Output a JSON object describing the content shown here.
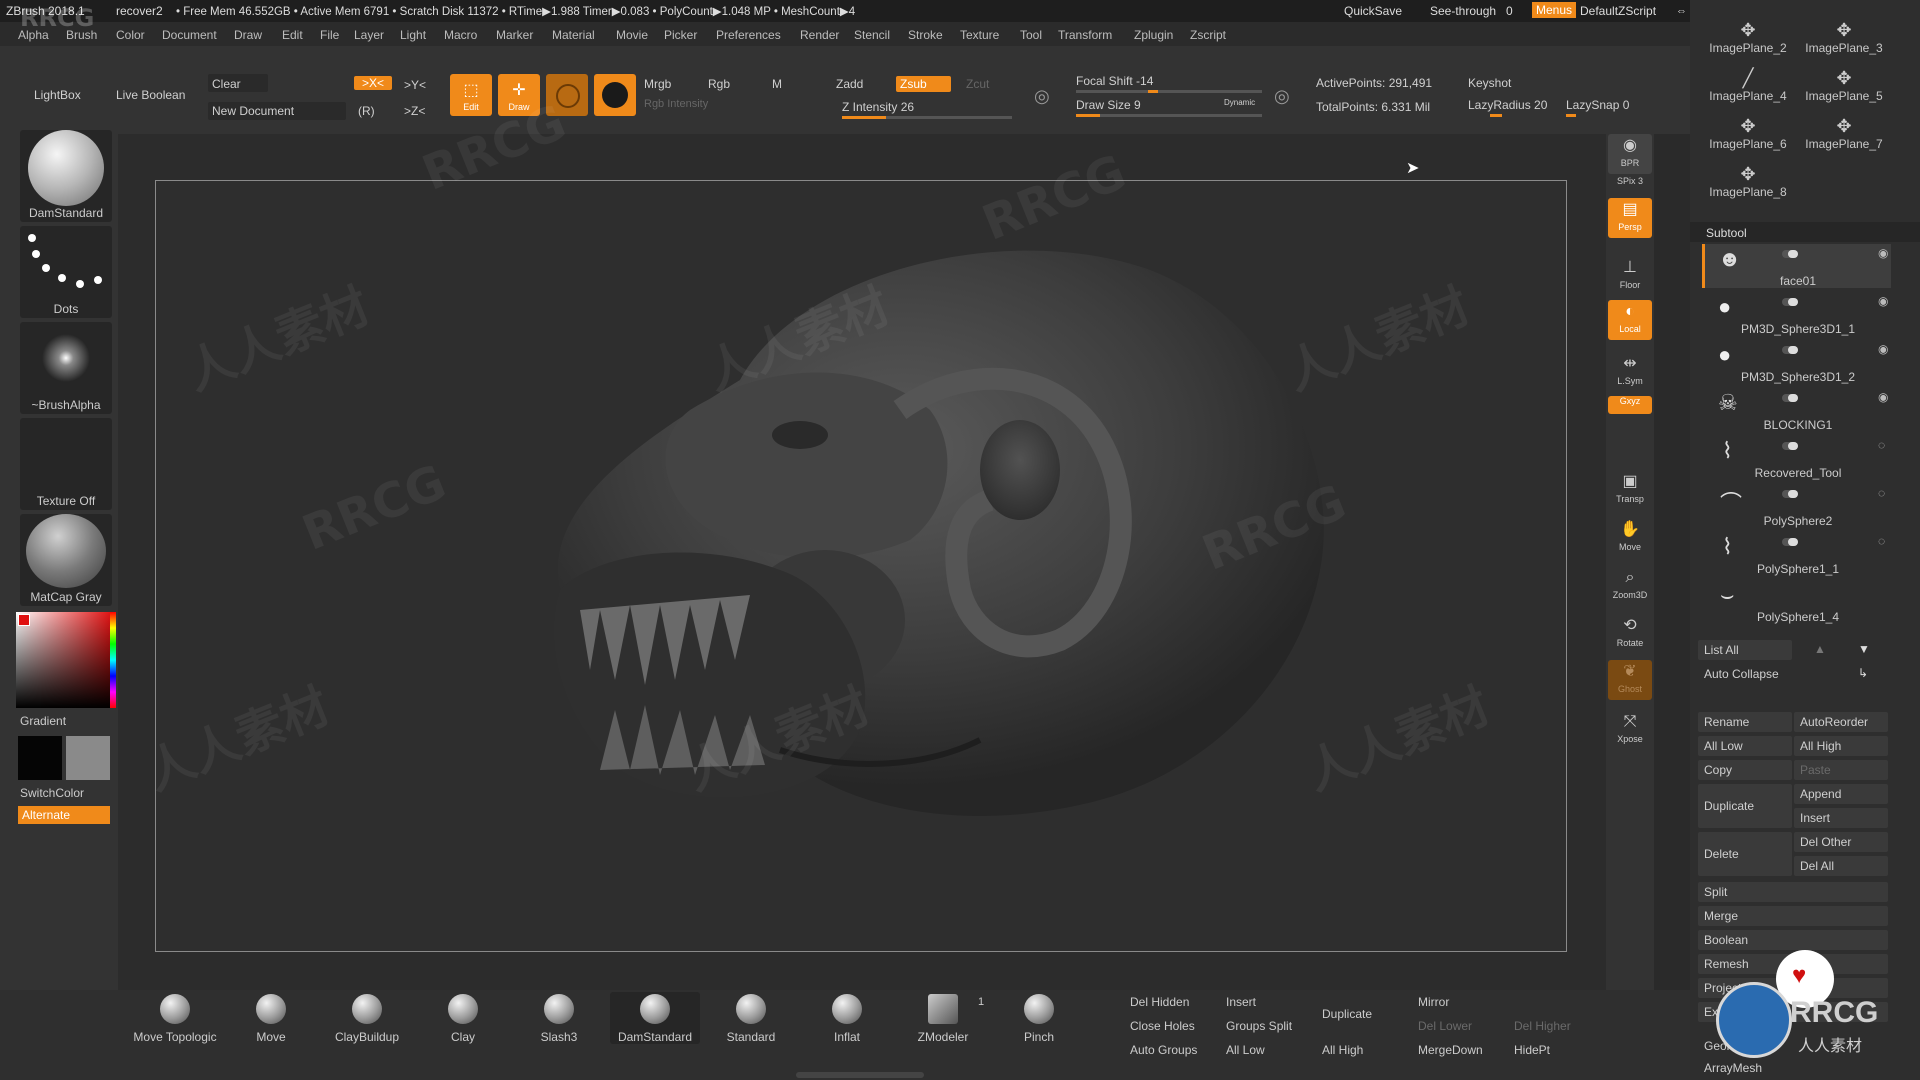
{
  "titlebar": {
    "app": "ZBrush 2018.1",
    "file": "recover2",
    "stats": "• Free Mem 46.552GB • Active Mem 6791 • Scratch Disk 11372 • RTime▶1.988 Timer▶0.083 • PolyCount▶1.048 MP • MeshCount▶4",
    "quicksave": "QuickSave",
    "see_through_label": "See-through",
    "see_through_value": "0",
    "menus": "Menus",
    "script": "DefaultZScript"
  },
  "menu": [
    "Alpha",
    "Brush",
    "Color",
    "Document",
    "Draw",
    "Edit",
    "File",
    "Layer",
    "Light",
    "Macro",
    "Marker",
    "Material",
    "Movie",
    "Picker",
    "Preferences",
    "Render",
    "Stencil",
    "Stroke",
    "Texture",
    "Tool",
    "Transform",
    "Zplugin",
    "Zscript"
  ],
  "top": {
    "lightbox": "LightBox",
    "live_boolean": "Live Boolean",
    "clear": "Clear",
    "new_document": "New Document",
    "x_mirror": ">X<",
    "y_mirror": ">Y<",
    "z_mirror": ">Z<",
    "r": "(R)",
    "edit": "Edit",
    "draw": "Draw",
    "mrgb": "Mrgb",
    "rgb": "Rgb",
    "m": "M",
    "rgb_intensity": "Rgb Intensity",
    "zadd": "Zadd",
    "zsub": "Zsub",
    "zcut": "Zcut",
    "z_intensity": "Z Intensity 26",
    "z_intensity_fraction": 0.26,
    "focal_shift": "Focal Shift -14",
    "draw_size": "Draw Size 9",
    "dynamic": "Dynamic",
    "active_points": "ActivePoints: 291,491",
    "total_points": "TotalPoints: 6.331 Mil",
    "keyshot": "Keyshot",
    "lazy_radius": "LazyRadius 20",
    "lazy_snap": "LazySnap 0"
  },
  "left": {
    "brush": "DamStandard",
    "stroke": "Dots",
    "alpha": "~BrushAlpha",
    "texture": "Texture Off",
    "material": "MatCap Gray",
    "gradient": "Gradient",
    "switch_color": "SwitchColor",
    "alternate": "Alternate"
  },
  "right_shelf": [
    {
      "name": "bpr-button",
      "label": "BPR",
      "icon": "render-icon"
    },
    {
      "name": "spix-label",
      "label": "SPix 3",
      "icon": ""
    },
    {
      "name": "persp-button",
      "label": "Persp",
      "icon": "perspective-icon"
    },
    {
      "name": "floor-button",
      "label": "Floor",
      "icon": "floor-icon"
    },
    {
      "name": "local-button",
      "label": "Local",
      "icon": "local-icon"
    },
    {
      "name": "lsym-button",
      "label": "L.Sym",
      "icon": "symmetry-icon"
    },
    {
      "name": "xyz-button",
      "label": "Gxyz",
      "icon": "axis-icon"
    },
    {
      "name": "transp-button",
      "label": "Transp",
      "icon": "transparency-icon"
    },
    {
      "name": "move-button",
      "label": "Move",
      "icon": "hand-icon"
    },
    {
      "name": "zoom3d-button",
      "label": "Zoom3D",
      "icon": "zoom-icon"
    },
    {
      "name": "rotate-button",
      "label": "Rotate",
      "icon": "rotate-icon"
    },
    {
      "name": "ghost-button",
      "label": "Ghost",
      "icon": "ghost-icon"
    },
    {
      "name": "xpose-button",
      "label": "Xpose",
      "icon": "xpose-icon"
    }
  ],
  "imageplanes": [
    "ImagePlane_2",
    "ImagePlane_3",
    "ImagePlane_4",
    "ImagePlane_5",
    "ImagePlane_6",
    "ImagePlane_7",
    "ImagePlane_8"
  ],
  "subtool": {
    "title": "Subtool",
    "items": [
      "face01",
      "PM3D_Sphere3D1_1",
      "PM3D_Sphere3D1_2",
      "BLOCKING1",
      "Recovered_Tool",
      "PolySphere2",
      "PolySphere1_1",
      "PolySphere1_4"
    ],
    "list_all": "List All",
    "auto_collapse": "Auto Collapse",
    "rename": "Rename",
    "auto_reorder": "AutoReorder",
    "all_low": "All Low",
    "all_high": "All High",
    "copy": "Copy",
    "paste": "Paste",
    "duplicate": "Duplicate",
    "append": "Append",
    "insert": "Insert",
    "delete": "Delete",
    "del_other": "Del Other",
    "del_all": "Del All",
    "split": "Split",
    "merge": "Merge",
    "boolean": "Boolean",
    "remesh": "Remesh",
    "project": "Project",
    "extract": "Ex",
    "geometry": "Geometry",
    "arraymesh": "ArrayMesh"
  },
  "bottom_brushes": [
    "Move Topologic",
    "Move",
    "ClayBuildup",
    "Clay",
    "Slash3",
    "DamStandard",
    "Standard",
    "Inflat",
    "ZModeler",
    "Pinch"
  ],
  "zmodeler_count": "1",
  "bottom_grid": {
    "del_hidden": "Del Hidden",
    "insert": "Insert",
    "duplicate": "Duplicate",
    "mirror": "Mirror",
    "close_holes": "Close Holes",
    "groups_split": "Groups Split",
    "del_lower": "Del Lower",
    "del_higher": "Del Higher",
    "auto_groups": "Auto Groups",
    "all_low": "All Low",
    "all_high": "All High",
    "merge_down": "MergeDown",
    "hide_pt": "HidePt"
  },
  "watermarks": [
    "RRCG",
    "人人素材"
  ],
  "logo_text": "RRCG",
  "logo_sub": "人人素材"
}
